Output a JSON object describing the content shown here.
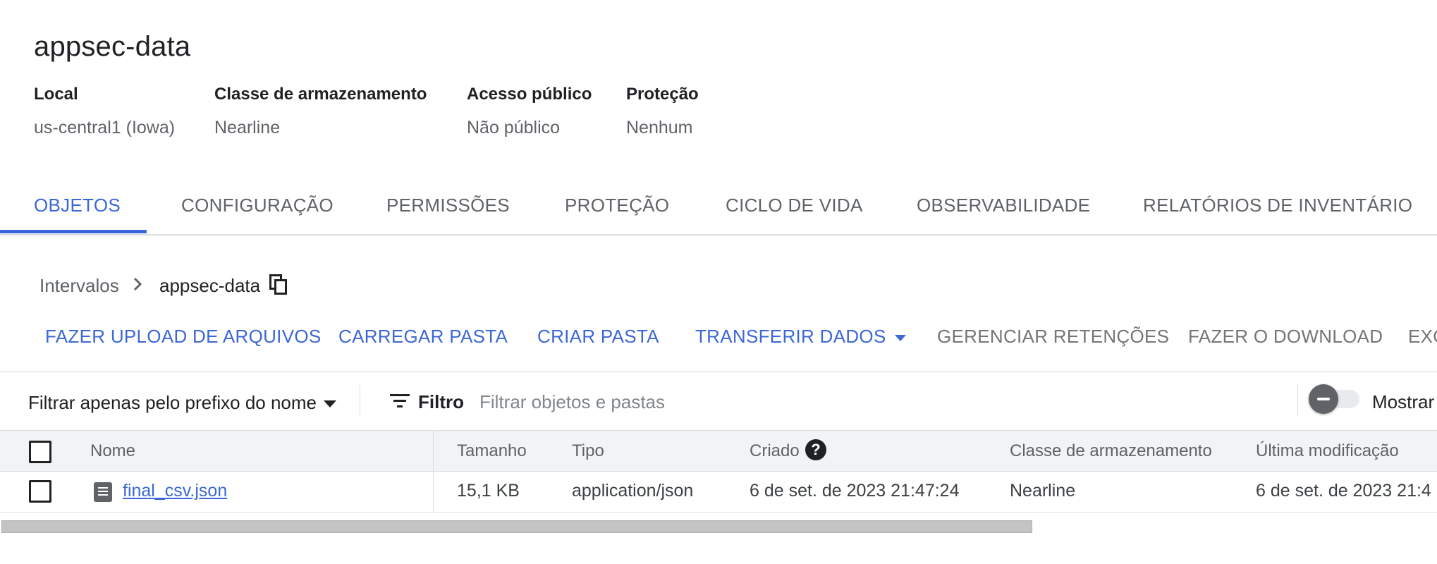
{
  "bucket": {
    "title": "appsec-data",
    "meta": [
      {
        "label": "Local",
        "value": "us-central1 (Iowa)"
      },
      {
        "label": "Classe de armazenamento",
        "value": "Nearline"
      },
      {
        "label": "Acesso público",
        "value": "Não público"
      },
      {
        "label": "Proteção",
        "value": "Nenhum"
      }
    ]
  },
  "tabs": [
    "OBJETOS",
    "CONFIGURAÇÃO",
    "PERMISSÕES",
    "PROTEÇÃO",
    "CICLO DE VIDA",
    "OBSERVABILIDADE",
    "RELATÓRIOS DE INVENTÁRIO"
  ],
  "active_tab": "OBJETOS",
  "breadcrumb": {
    "root": "Intervalos",
    "current": "appsec-data"
  },
  "actions": [
    {
      "label": "FAZER UPLOAD DE ARQUIVOS",
      "enabled": true
    },
    {
      "label": "CARREGAR PASTA",
      "enabled": true
    },
    {
      "label": "CRIAR PASTA",
      "enabled": true
    },
    {
      "label": "TRANSFERIR DADOS",
      "enabled": true
    },
    {
      "label": "GERENCIAR RETENÇÕES",
      "enabled": false
    },
    {
      "label": "FAZER O DOWNLOAD",
      "enabled": false
    },
    {
      "label": "EXC",
      "enabled": false
    }
  ],
  "filter": {
    "prefix_select": "Filtrar apenas pelo prefixo do nome",
    "filter_label": "Filtro",
    "placeholder": "Filtrar objetos e pastas",
    "toggle_label": "Mostrar"
  },
  "table": {
    "columns": [
      "Nome",
      "Tamanho",
      "Tipo",
      "Criado",
      "Classe de armazenamento",
      "Última modificação"
    ],
    "rows": [
      {
        "name": "final_csv.json",
        "size": "15,1 KB",
        "type": "application/json",
        "created": "6 de set. de 2023 21:47:24",
        "storage_class": "Nearline",
        "modified": "6 de set. de 2023 21:4"
      }
    ]
  },
  "colors": {
    "accent": "#3c67d6",
    "muted": "#5f6368"
  },
  "icons": [
    "chevron-right-icon",
    "copy-icon",
    "caret-down-icon",
    "filter-icon",
    "help-icon",
    "file-icon"
  ]
}
